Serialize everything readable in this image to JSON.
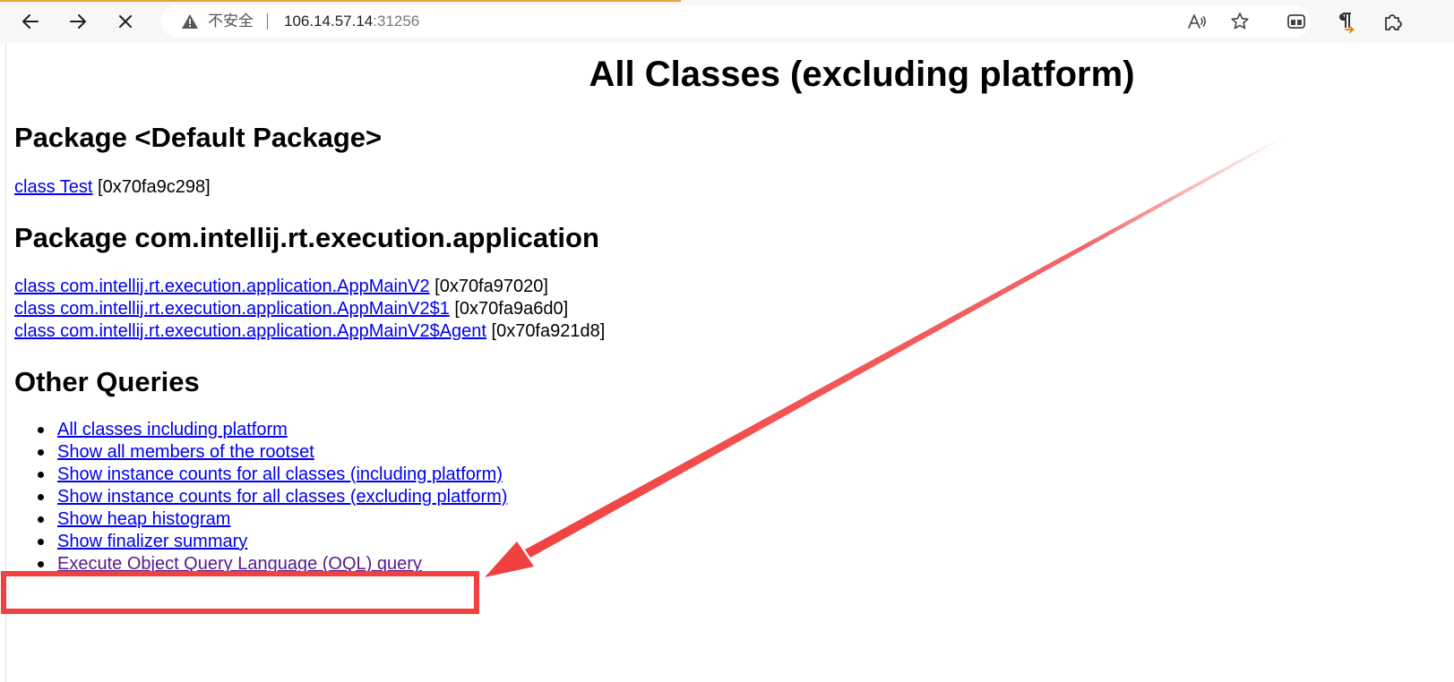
{
  "browser": {
    "security_label": "不安全",
    "url_host": "106.14.57.14",
    "url_port": ":31256",
    "back_icon": "back-arrow-icon",
    "forward_icon": "forward-arrow-icon",
    "stop_icon": "close-icon",
    "read_aloud_icon": "read-aloud-icon",
    "favorite_icon": "star-icon"
  },
  "page": {
    "title": "All Classes (excluding platform)",
    "sections": [
      {
        "heading": "Package <Default Package>",
        "classes": [
          {
            "link": "class Test",
            "address": " [0x70fa9c298]"
          }
        ]
      },
      {
        "heading": "Package com.intellij.rt.execution.application",
        "classes": [
          {
            "link": "class com.intellij.rt.execution.application.AppMainV2",
            "address": " [0x70fa97020]"
          },
          {
            "link": "class com.intellij.rt.execution.application.AppMainV2$1",
            "address": " [0x70fa9a6d0]"
          },
          {
            "link": "class com.intellij.rt.execution.application.AppMainV2$Agent",
            "address": " [0x70fa921d8]"
          }
        ]
      }
    ],
    "other_queries_heading": "Other Queries",
    "queries": [
      "All classes including platform",
      "Show all members of the rootset",
      "Show instance counts for all classes (including platform)",
      "Show instance counts for all classes (excluding platform)",
      "Show heap histogram",
      "Show finalizer summary",
      "Execute Object Query Language (OQL) query"
    ]
  },
  "annotation": {
    "color": "#f04040",
    "highlighted_item": "Execute Object Query Language (OQL) query"
  }
}
